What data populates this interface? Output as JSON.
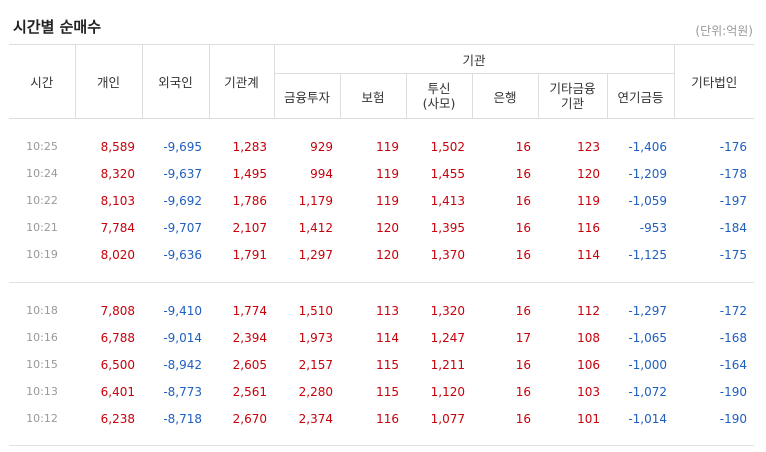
{
  "title": "시간별 순매수",
  "unit": "(단위:억원)",
  "headers": {
    "time": "시간",
    "individual": "개인",
    "foreign": "외국인",
    "inst_total": "기관계",
    "inst_group": "기관",
    "fin_invest": "금융투자",
    "insurance": "보험",
    "trust_line1": "투신",
    "trust_line2": "(사모)",
    "bank": "은행",
    "other_fin_line1": "기타금융",
    "other_fin_line2": "기관",
    "pension": "연기금등",
    "other_corp": "기타법인"
  },
  "groups": [
    {
      "rows": [
        {
          "time": "10:25",
          "individual": "8,589",
          "foreign": "-9,695",
          "inst_total": "1,283",
          "fin_invest": "929",
          "insurance": "119",
          "trust": "1,502",
          "bank": "16",
          "other_fin": "123",
          "pension": "-1,406",
          "other_corp": "-176"
        },
        {
          "time": "10:24",
          "individual": "8,320",
          "foreign": "-9,637",
          "inst_total": "1,495",
          "fin_invest": "994",
          "insurance": "119",
          "trust": "1,455",
          "bank": "16",
          "other_fin": "120",
          "pension": "-1,209",
          "other_corp": "-178"
        },
        {
          "time": "10:22",
          "individual": "8,103",
          "foreign": "-9,692",
          "inst_total": "1,786",
          "fin_invest": "1,179",
          "insurance": "119",
          "trust": "1,413",
          "bank": "16",
          "other_fin": "119",
          "pension": "-1,059",
          "other_corp": "-197"
        },
        {
          "time": "10:21",
          "individual": "7,784",
          "foreign": "-9,707",
          "inst_total": "2,107",
          "fin_invest": "1,412",
          "insurance": "120",
          "trust": "1,395",
          "bank": "16",
          "other_fin": "116",
          "pension": "-953",
          "other_corp": "-184"
        },
        {
          "time": "10:19",
          "individual": "8,020",
          "foreign": "-9,636",
          "inst_total": "1,791",
          "fin_invest": "1,297",
          "insurance": "120",
          "trust": "1,370",
          "bank": "16",
          "other_fin": "114",
          "pension": "-1,125",
          "other_corp": "-175"
        }
      ]
    },
    {
      "rows": [
        {
          "time": "10:18",
          "individual": "7,808",
          "foreign": "-9,410",
          "inst_total": "1,774",
          "fin_invest": "1,510",
          "insurance": "113",
          "trust": "1,320",
          "bank": "16",
          "other_fin": "112",
          "pension": "-1,297",
          "other_corp": "-172"
        },
        {
          "time": "10:16",
          "individual": "6,788",
          "foreign": "-9,014",
          "inst_total": "2,394",
          "fin_invest": "1,973",
          "insurance": "114",
          "trust": "1,247",
          "bank": "17",
          "other_fin": "108",
          "pension": "-1,065",
          "other_corp": "-168"
        },
        {
          "time": "10:15",
          "individual": "6,500",
          "foreign": "-8,942",
          "inst_total": "2,605",
          "fin_invest": "2,157",
          "insurance": "115",
          "trust": "1,211",
          "bank": "16",
          "other_fin": "106",
          "pension": "-1,000",
          "other_corp": "-164"
        },
        {
          "time": "10:13",
          "individual": "6,401",
          "foreign": "-8,773",
          "inst_total": "2,561",
          "fin_invest": "2,280",
          "insurance": "115",
          "trust": "1,120",
          "bank": "16",
          "other_fin": "103",
          "pension": "-1,072",
          "other_corp": "-190"
        },
        {
          "time": "10:12",
          "individual": "6,238",
          "foreign": "-8,718",
          "inst_total": "2,670",
          "fin_invest": "2,374",
          "insurance": "116",
          "trust": "1,077",
          "bank": "16",
          "other_fin": "101",
          "pension": "-1,014",
          "other_corp": "-190"
        }
      ]
    }
  ],
  "colors": {
    "positive": "#c8000a",
    "negative": "#1f5fbf",
    "time": "#999999"
  }
}
